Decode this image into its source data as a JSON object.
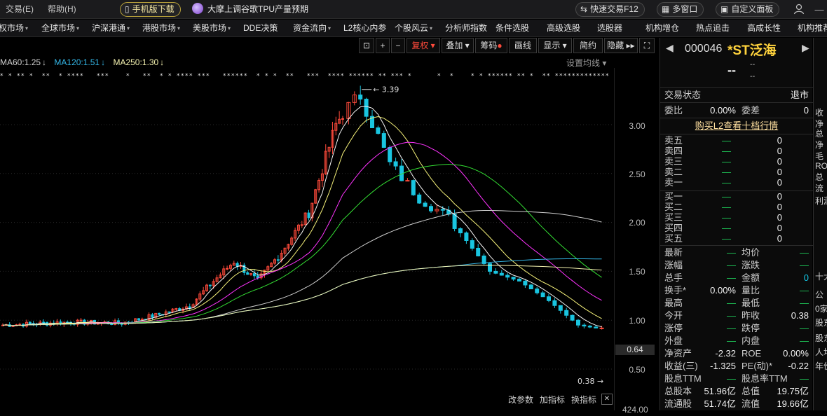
{
  "titlebar": {
    "trade": "交易(E)",
    "help": "帮助(H)",
    "mobile": "手机版下载",
    "news": "大摩上调谷歌TPU产量预期",
    "quick_trade": "快速交易F12",
    "multi_window": "多窗口",
    "custom_panel": "自定义面板"
  },
  "menu": [
    "权市场",
    "全球市场",
    "沪深港通",
    "港股市场",
    "美股市场",
    "DDE决策",
    "资金流向",
    "L2核心内参",
    "个股风云",
    "分析师指数",
    "条件选股",
    "高级选股",
    "选股器",
    "机构增仓",
    "热点追击",
    "高成长性",
    "机构推荐"
  ],
  "toolbar": {
    "fq": "复权",
    "overlay": "叠加",
    "chips": "筹码",
    "draw": "画线",
    "display": "显示",
    "simple": "简约",
    "hide": "隐藏"
  },
  "ma": {
    "ma60": "MA60:1.25",
    "ma120": "MA120:1.51",
    "ma250": "MA250:1.30",
    "setting": "设置均线"
  },
  "yaxis": [
    "3.00",
    "2.50",
    "2.00",
    "1.50",
    "1.00",
    "0.50"
  ],
  "last_price": "0.64",
  "high_mark": "3.39",
  "low_mark": "0.38",
  "volume_partial": "424.00",
  "bottom": {
    "params": "改参数",
    "add_indicator": "加指标",
    "swap_indicator": "换指标"
  },
  "stock": {
    "code": "000046",
    "name": "*ST泛海",
    "price": "--",
    "chg1": "--",
    "chg2": "--",
    "status_label": "交易状态",
    "status": "退市",
    "weibi_label": "委比",
    "weibi": "0.00%",
    "weicha_label": "委差",
    "weicha": "0",
    "l2_link": "购买L2查看十档行情"
  },
  "asks": [
    {
      "label": "卖五",
      "price": "—",
      "vol": "0"
    },
    {
      "label": "卖四",
      "price": "—",
      "vol": "0"
    },
    {
      "label": "卖三",
      "price": "—",
      "vol": "0"
    },
    {
      "label": "卖二",
      "price": "—",
      "vol": "0"
    },
    {
      "label": "卖一",
      "price": "—",
      "vol": "0"
    }
  ],
  "bids": [
    {
      "label": "买一",
      "price": "—",
      "vol": "0"
    },
    {
      "label": "买二",
      "price": "—",
      "vol": "0"
    },
    {
      "label": "买三",
      "price": "—",
      "vol": "0"
    },
    {
      "label": "买四",
      "price": "—",
      "vol": "0"
    },
    {
      "label": "买五",
      "price": "—",
      "vol": "0"
    }
  ],
  "stats": [
    {
      "l1": "最新",
      "v1": "—",
      "l2": "均价",
      "v2": "—"
    },
    {
      "l1": "涨幅",
      "v1": "—",
      "l2": "涨跌",
      "v2": "—"
    },
    {
      "l1": "总手",
      "v1": "—",
      "l2": "金额",
      "v2": "0"
    },
    {
      "l1": "换手*",
      "v1": "0.00%",
      "l2": "量比",
      "v2": "—"
    },
    {
      "l1": "最高",
      "v1": "—",
      "l2": "最低",
      "v2": "—"
    },
    {
      "l1": "今开",
      "v1": "—",
      "l2": "昨收",
      "v2": "0.38"
    },
    {
      "l1": "涨停",
      "v1": "—",
      "l2": "跌停",
      "v2": "—"
    },
    {
      "l1": "外盘",
      "v1": "—",
      "l2": "内盘",
      "v2": "—"
    },
    {
      "l1": "净资产",
      "v1": "-2.32",
      "l2": "ROE",
      "v2": "0.00%"
    },
    {
      "l1": "收益(三)",
      "v1": "-1.325",
      "l2": "PE(动)*",
      "v2": "-0.22"
    },
    {
      "l1": "股息TTM",
      "v1": "—",
      "l2": "股息率TTM",
      "v2": "—"
    },
    {
      "l1": "总股本",
      "v1": "51.96亿",
      "l2": "总值",
      "v2": "19.75亿"
    },
    {
      "l1": "流通股",
      "v1": "51.74亿",
      "l2": "流值",
      "v2": "19.66亿"
    }
  ],
  "far_panel": [
    "收",
    "净",
    "总",
    "净",
    "毛",
    "RO",
    "总",
    "流",
    "利润",
    "十大",
    "公",
    "0家",
    "股东",
    "股东",
    "人均",
    "年份"
  ],
  "colors": {
    "up": "#ff4a3b",
    "down": "#19c5e0",
    "ma5": "#f5f5f5",
    "ma10": "#f6f27a",
    "ma20": "#ff33ff",
    "ma30": "#33dd33",
    "ma60": "#d0d0d0",
    "ma120": "#33b5e5",
    "ma250": "#f5f3b0"
  }
}
